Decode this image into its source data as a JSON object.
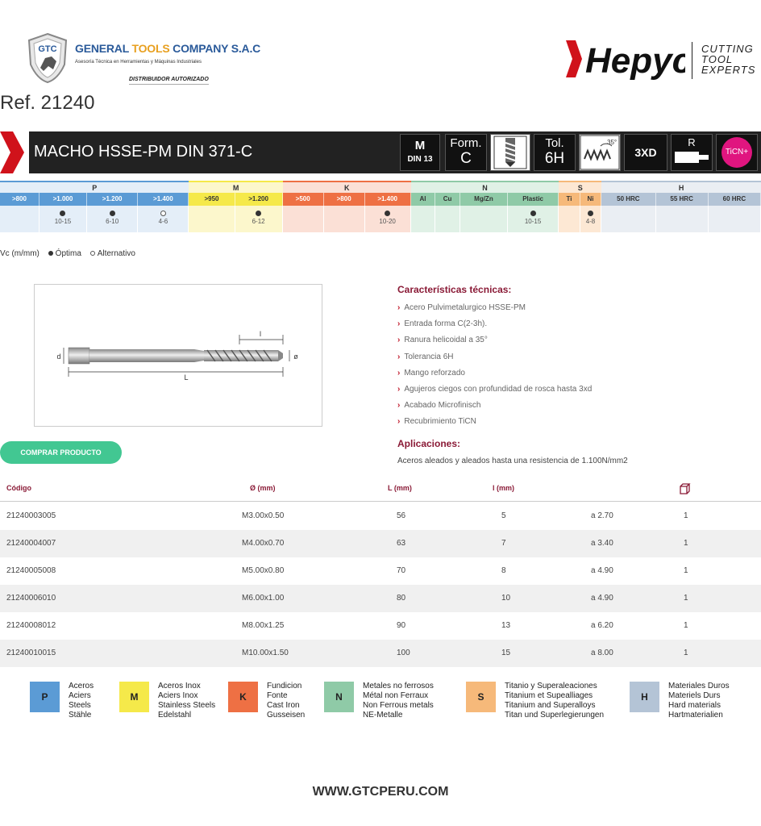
{
  "header": {
    "gtc_badge": "GTC",
    "gtc_name_a": "GENERAL",
    "gtc_name_b": "TOOLS",
    "gtc_name_c": "COMPANY S.A.C",
    "gtc_sub": "Asesoría Técnica en Herramientas y Máquinas Industriales",
    "gtc_dist": "DISTRIBUIDOR AUTORIZADO",
    "brand": "Hepyc",
    "brand_tag": [
      "CUTTING",
      "TOOL",
      "EXPERTS"
    ],
    "ref": "Ref. 21240"
  },
  "title_bar": {
    "title": "MACHO HSSE-PM DIN 371-C",
    "m_label": "M",
    "m_sub": "DIN 13",
    "form_label": "Form.",
    "form_value": "C",
    "tol_label": "Tol.",
    "tol_value": "6H",
    "helix_angle": "35°",
    "depth": "3XD",
    "r_label": "R",
    "coating": "TiCN+",
    "icons": [
      "tap-icon",
      "helix-icon",
      "shank-icon"
    ]
  },
  "materials": {
    "groups": [
      {
        "name": "P",
        "color": "#5b9bd5",
        "light": "#e4eef8"
      },
      {
        "name": "M",
        "color": "#f5e94a",
        "light": "#fcf7cc"
      },
      {
        "name": "K",
        "color": "#ee7044",
        "light": "#fbe0d6"
      },
      {
        "name": "N",
        "color": "#8fcaa7",
        "light": "#e0f1e6"
      },
      {
        "name": "S",
        "color": "#f6b97a",
        "light": "#fde8d4"
      },
      {
        "name": "H",
        "color": "#b4c4d6",
        "light": "#eaeef3"
      }
    ],
    "sub": [
      ">800",
      ">1.000",
      ">1.200",
      ">1.400",
      ">950",
      ">1.200",
      ">500",
      ">800",
      ">1.400",
      "Al",
      "Cu",
      "Mg/Zn",
      "Plastic",
      "Ti",
      "Ni",
      "50 HRC",
      "55 HRC",
      "60 HRC"
    ],
    "values": [
      {
        "dot": "",
        "range": ""
      },
      {
        "dot": "optimal",
        "range": "10-15"
      },
      {
        "dot": "optimal",
        "range": "6-10"
      },
      {
        "dot": "alternative",
        "range": "4-6"
      },
      {
        "dot": "",
        "range": ""
      },
      {
        "dot": "optimal",
        "range": "6-12"
      },
      {
        "dot": "",
        "range": ""
      },
      {
        "dot": "",
        "range": ""
      },
      {
        "dot": "optimal",
        "range": "10-20"
      },
      {
        "dot": "",
        "range": ""
      },
      {
        "dot": "",
        "range": ""
      },
      {
        "dot": "",
        "range": ""
      },
      {
        "dot": "optimal",
        "range": "10-15"
      },
      {
        "dot": "",
        "range": ""
      },
      {
        "dot": "optimal",
        "range": "4-8"
      },
      {
        "dot": "",
        "range": ""
      },
      {
        "dot": "",
        "range": ""
      },
      {
        "dot": "",
        "range": ""
      }
    ],
    "legend_vc": "Vc (m/mm)",
    "legend_opt": "Óptima",
    "legend_alt": "Alternativo"
  },
  "drawing": {
    "l": "l",
    "d": "d",
    "L": "L",
    "o": "ø"
  },
  "characteristics": {
    "title": "Características técnicas:",
    "items": [
      "Acero Pulvimetalurgico HSSE-PM",
      "Entrada forma C(2-3h).",
      "Ranura helicoidal a 35°",
      "Tolerancia 6H",
      "Mango reforzado",
      "Agujeros ciegos con profundidad de rosca hasta 3xd",
      "Acabado Microfinisch",
      "Recubrimiento TiCN"
    ]
  },
  "applications": {
    "title": "Aplicaciones:",
    "text": "Aceros aleados y aleados hasta una resistencia de 1.100N/mm2"
  },
  "buy_button": "COMPRAR PRODUCTO",
  "table": {
    "headers": [
      "Código",
      "Ø (mm)",
      "L (mm)",
      "l (mm)",
      "",
      "box-icon"
    ],
    "rows": [
      [
        "21240003005",
        "M3.00x0.50",
        "56",
        "5",
        "a 2.70",
        "1"
      ],
      [
        "21240004007",
        "M4.00x0.70",
        "63",
        "7",
        "a 3.40",
        "1"
      ],
      [
        "21240005008",
        "M5.00x0.80",
        "70",
        "8",
        "a 4.90",
        "1"
      ],
      [
        "21240006010",
        "M6.00x1.00",
        "80",
        "10",
        "a 4.90",
        "1"
      ],
      [
        "21240008012",
        "M8.00x1.25",
        "90",
        "13",
        "a 6.20",
        "1"
      ],
      [
        "21240010015",
        "M10.00x1.50",
        "100",
        "15",
        "a 8.00",
        "1"
      ]
    ]
  },
  "bottom_legend": [
    {
      "letter": "P",
      "color": "#5b9bd5",
      "lines": [
        "Aceros",
        "Aciers",
        "Steels",
        "Stähle"
      ]
    },
    {
      "letter": "M",
      "color": "#f5e94a",
      "lines": [
        "Aceros Inox",
        "Aciers Inox",
        "Stainless Steels",
        "Edelstahl"
      ]
    },
    {
      "letter": "K",
      "color": "#ee7044",
      "lines": [
        "Fundicion",
        "Fonte",
        "Cast Iron",
        "Gusseisen"
      ]
    },
    {
      "letter": "N",
      "color": "#8fcaa7",
      "lines": [
        "Metales no ferrosos",
        "Métal non Ferraux",
        "Non Ferrous metals",
        "NE-Metalle"
      ]
    },
    {
      "letter": "S",
      "color": "#f6b97a",
      "lines": [
        "Titanio y Superaleaciones",
        "Titanium et Supealliages",
        "Titanium and Superalloys",
        "Titan und Superlegierungen"
      ]
    },
    {
      "letter": "H",
      "color": "#b4c4d6",
      "lines": [
        "Materiales Duros",
        "Materiels Durs",
        "Hard materials",
        "Hartmaterialien"
      ]
    }
  ],
  "footer": "WWW.GTCPERU.COM"
}
